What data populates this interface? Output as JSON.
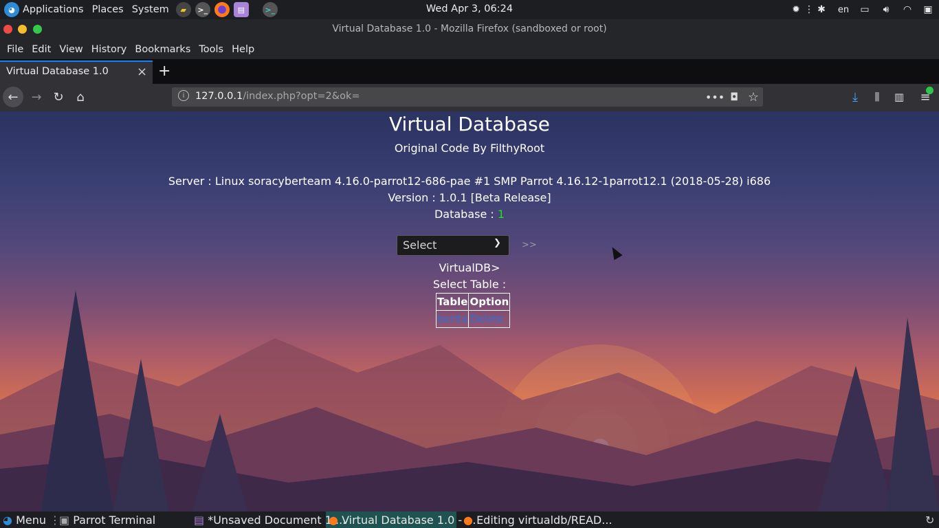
{
  "system_panel": {
    "applications_label": "Applications",
    "places_label": "Places",
    "system_label": "System",
    "clock": "Wed Apr  3, 06:24",
    "keyboard_layout": "en",
    "colors": {
      "panel_bg": "#1d1e22"
    }
  },
  "window": {
    "title": "Virtual Database 1.0 - Mozilla Firefox (sandboxed or root)"
  },
  "menubar": {
    "items": [
      {
        "label": "File"
      },
      {
        "label": "Edit"
      },
      {
        "label": "View"
      },
      {
        "label": "History"
      },
      {
        "label": "Bookmarks"
      },
      {
        "label": "Tools"
      },
      {
        "label": "Help"
      }
    ]
  },
  "tabs": [
    {
      "label": "Virtual Database 1.0",
      "active": true
    }
  ],
  "urlbar": {
    "host": "127.0.0.1",
    "path": "/index.php?opt=2&ok="
  },
  "page": {
    "title": "Virtual Database",
    "subtitle": "Original Code By FilthyRoot",
    "server_line": "Server : Linux soracyberteam 4.16.0-parrot12-686-pae #1 SMP Parrot 4.16.12-1parrot12.1 (2018-05-28) i686",
    "version_line": "Version : 1.0.1 [Beta Release]",
    "database_label": "Database : ",
    "database_count": "1",
    "select_value": "Select",
    "go_label": ">>",
    "prompt": "VirtualDB>",
    "select_table_label": "Select Table :",
    "table": {
      "headers": [
        "Table",
        "Option"
      ],
      "rows": [
        [
          "berita",
          "Delete"
        ]
      ]
    },
    "colors": {
      "text": "#ffffff",
      "link": "#2f6fd8",
      "count": "#22dd22"
    }
  },
  "taskbar": {
    "menu_label": "Menu",
    "tasks": [
      {
        "label": "Parrot Terminal"
      },
      {
        "label": "*Unsaved Document 1 ..."
      },
      {
        "label": "Virtual Database 1.0 - ...",
        "active": true
      },
      {
        "label": "Editing virtualdb/READ..."
      }
    ]
  }
}
